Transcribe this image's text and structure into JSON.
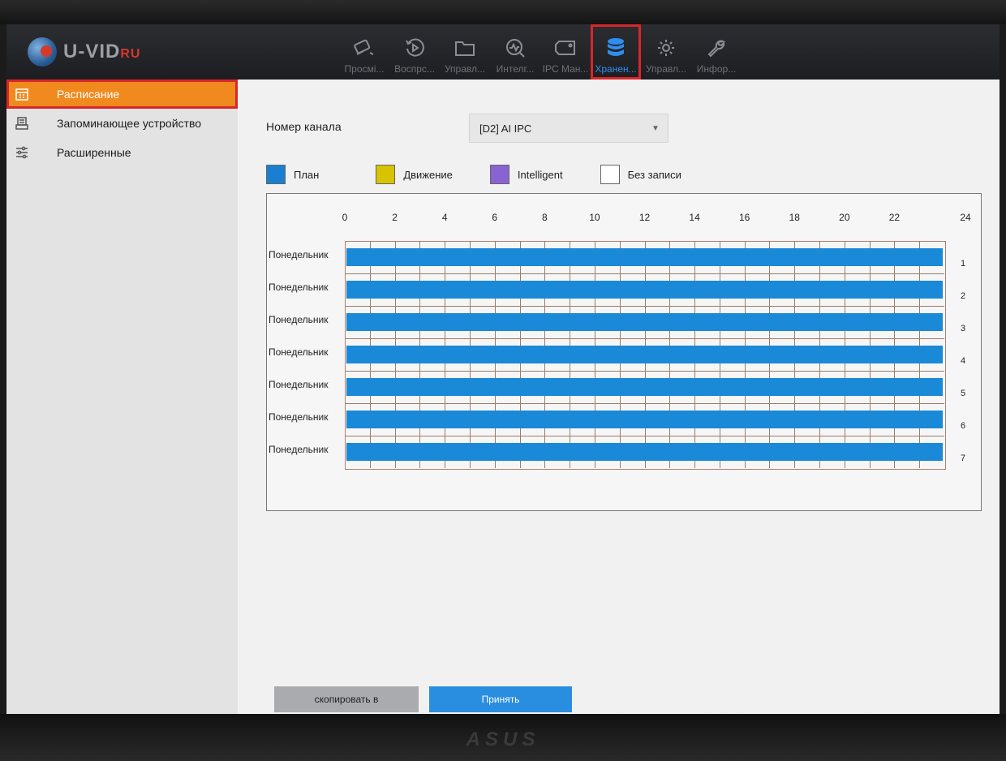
{
  "brand": {
    "logo_text": "U-VID",
    "logo_suffix": "RU"
  },
  "topnav": {
    "items": [
      {
        "label": "Просмі...",
        "icon": "camera-icon"
      },
      {
        "label": "Воспрс...",
        "icon": "playback-icon"
      },
      {
        "label": "Управл...",
        "icon": "folder-icon"
      },
      {
        "label": "Интелг...",
        "icon": "analytics-icon"
      },
      {
        "label": "IPC Ман...",
        "icon": "ipc-icon"
      },
      {
        "label": "Хранен...",
        "icon": "storage-icon",
        "active": true
      },
      {
        "label": "Управл...",
        "icon": "gear-icon"
      },
      {
        "label": "Инфор...",
        "icon": "wrench-icon"
      }
    ]
  },
  "sidebar": {
    "items": [
      {
        "label": "Расписание",
        "icon": "calendar-icon",
        "active": true
      },
      {
        "label": "Запоминающее устройство",
        "icon": "hdd-icon"
      },
      {
        "label": "Расширенные",
        "icon": "sliders-icon"
      }
    ]
  },
  "channel": {
    "label": "Номер канала",
    "value": "[D2] AI IPC"
  },
  "legend": [
    {
      "label": "План",
      "color": "#1a7fd0"
    },
    {
      "label": "Движение",
      "color": "#d8c300"
    },
    {
      "label": "Intelligent",
      "color": "#8a63d2"
    },
    {
      "label": "Без записи",
      "color": "#ffffff"
    }
  ],
  "schedule": {
    "hours": [
      "0",
      "2",
      "4",
      "6",
      "8",
      "10",
      "12",
      "14",
      "16",
      "18",
      "20",
      "22",
      "24"
    ],
    "days": [
      {
        "name": "Понедельник",
        "num": "1"
      },
      {
        "name": "Понедельник",
        "num": "2"
      },
      {
        "name": "Понедельник",
        "num": "3"
      },
      {
        "name": "Понедельник",
        "num": "4"
      },
      {
        "name": "Понедельник",
        "num": "5"
      },
      {
        "name": "Понедельник",
        "num": "6"
      },
      {
        "name": "Понедельник",
        "num": "7"
      }
    ],
    "bar_color": "#1a89d8"
  },
  "buttons": {
    "copy": "скопировать в",
    "apply": "Принять"
  },
  "monitor": {
    "brand": "ASUS"
  }
}
